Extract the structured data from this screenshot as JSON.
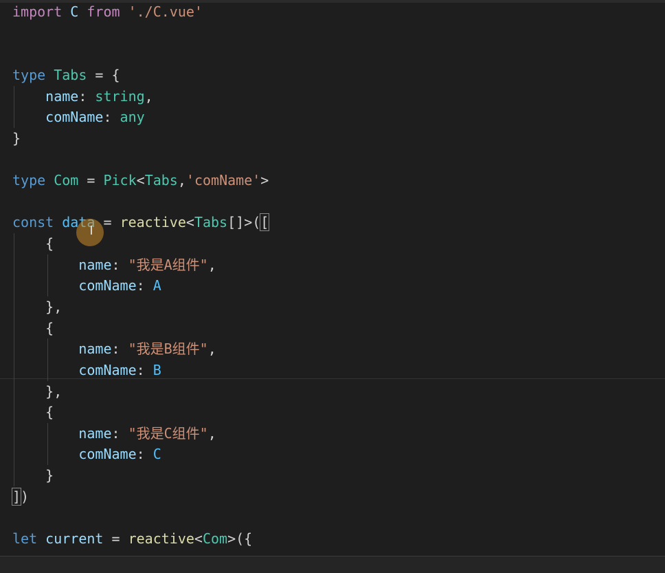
{
  "editor": {
    "lines": [
      [
        {
          "t": "import",
          "c": "ctrl"
        },
        {
          "t": " C ",
          "c": "var"
        },
        {
          "t": "from",
          "c": "ctrl"
        },
        {
          "t": " ",
          "c": "plain"
        },
        {
          "t": "'./C.vue'",
          "c": "str"
        }
      ],
      [],
      [],
      [
        {
          "t": "type",
          "c": "kw"
        },
        {
          "t": " ",
          "c": "plain"
        },
        {
          "t": "Tabs",
          "c": "type"
        },
        {
          "t": " = {",
          "c": "plain"
        }
      ],
      [
        {
          "t": "    name",
          "c": "var"
        },
        {
          "t": ": ",
          "c": "plain"
        },
        {
          "t": "string",
          "c": "type"
        },
        {
          "t": ",",
          "c": "plain"
        }
      ],
      [
        {
          "t": "    comName",
          "c": "var"
        },
        {
          "t": ": ",
          "c": "plain"
        },
        {
          "t": "any",
          "c": "type"
        }
      ],
      [
        {
          "t": "}",
          "c": "plain"
        }
      ],
      [],
      [
        {
          "t": "type",
          "c": "kw"
        },
        {
          "t": " ",
          "c": "plain"
        },
        {
          "t": "Com",
          "c": "type"
        },
        {
          "t": " = ",
          "c": "plain"
        },
        {
          "t": "Pick",
          "c": "type"
        },
        {
          "t": "<",
          "c": "plain"
        },
        {
          "t": "Tabs",
          "c": "type"
        },
        {
          "t": ",",
          "c": "plain"
        },
        {
          "t": "'comName'",
          "c": "str"
        },
        {
          "t": ">",
          "c": "plain"
        }
      ],
      [],
      [
        {
          "t": "const",
          "c": "kw"
        },
        {
          "t": " ",
          "c": "plain"
        },
        {
          "t": "data",
          "c": "const"
        },
        {
          "t": " = ",
          "c": "plain"
        },
        {
          "t": "reactive",
          "c": "fn"
        },
        {
          "t": "<",
          "c": "plain"
        },
        {
          "t": "Tabs",
          "c": "type"
        },
        {
          "t": "[]>(",
          "c": "plain"
        },
        {
          "t": "[",
          "c": "plain",
          "box": true
        }
      ],
      [
        {
          "t": "    {",
          "c": "plain"
        }
      ],
      [
        {
          "t": "        name",
          "c": "var"
        },
        {
          "t": ": ",
          "c": "plain"
        },
        {
          "t": "\"我是A组件\"",
          "c": "str"
        },
        {
          "t": ",",
          "c": "plain"
        }
      ],
      [
        {
          "t": "        comName",
          "c": "var"
        },
        {
          "t": ": ",
          "c": "plain"
        },
        {
          "t": "A",
          "c": "const"
        }
      ],
      [
        {
          "t": "    },",
          "c": "plain"
        }
      ],
      [
        {
          "t": "    {",
          "c": "plain"
        }
      ],
      [
        {
          "t": "        name",
          "c": "var"
        },
        {
          "t": ": ",
          "c": "plain"
        },
        {
          "t": "\"我是B组件\"",
          "c": "str"
        },
        {
          "t": ",",
          "c": "plain"
        }
      ],
      [
        {
          "t": "        comName",
          "c": "var"
        },
        {
          "t": ": ",
          "c": "plain"
        },
        {
          "t": "B",
          "c": "const"
        }
      ],
      [
        {
          "t": "    },",
          "c": "plain"
        }
      ],
      [
        {
          "t": "    {",
          "c": "plain"
        }
      ],
      [
        {
          "t": "        name",
          "c": "var"
        },
        {
          "t": ": ",
          "c": "plain"
        },
        {
          "t": "\"我是C组件\"",
          "c": "str"
        },
        {
          "t": ",",
          "c": "plain"
        }
      ],
      [
        {
          "t": "        comName",
          "c": "var"
        },
        {
          "t": ": ",
          "c": "plain"
        },
        {
          "t": "C",
          "c": "const"
        }
      ],
      [
        {
          "t": "    }",
          "c": "plain"
        }
      ],
      [
        {
          "t": "]",
          "c": "plain",
          "box": true
        },
        {
          "t": ")",
          "c": "plain"
        }
      ],
      [],
      [
        {
          "t": "let",
          "c": "kw"
        },
        {
          "t": " ",
          "c": "plain"
        },
        {
          "t": "current",
          "c": "var"
        },
        {
          "t": " = ",
          "c": "plain"
        },
        {
          "t": "reactive",
          "c": "fn"
        },
        {
          "t": "<",
          "c": "plain"
        },
        {
          "t": "Com",
          "c": "type"
        },
        {
          "t": ">({",
          "c": "plain"
        }
      ]
    ],
    "indent_guides": {
      "level1": [
        4,
        5,
        11,
        12,
        13,
        14,
        15,
        16,
        17,
        18,
        19,
        20,
        21,
        22
      ],
      "level2": [
        12,
        13,
        16,
        17,
        20,
        21
      ]
    },
    "colors": {
      "background": "#1e1e1e",
      "keyword": "#569cd6",
      "control": "#c586c0",
      "type": "#4ec9b0",
      "variable": "#9cdcfe",
      "function": "#dcdcaa",
      "string": "#ce9178",
      "constant": "#4fc1ff",
      "cursor_highlight": "#cc8c28"
    },
    "cursor_icon": "i-beam-cursor-icon"
  }
}
